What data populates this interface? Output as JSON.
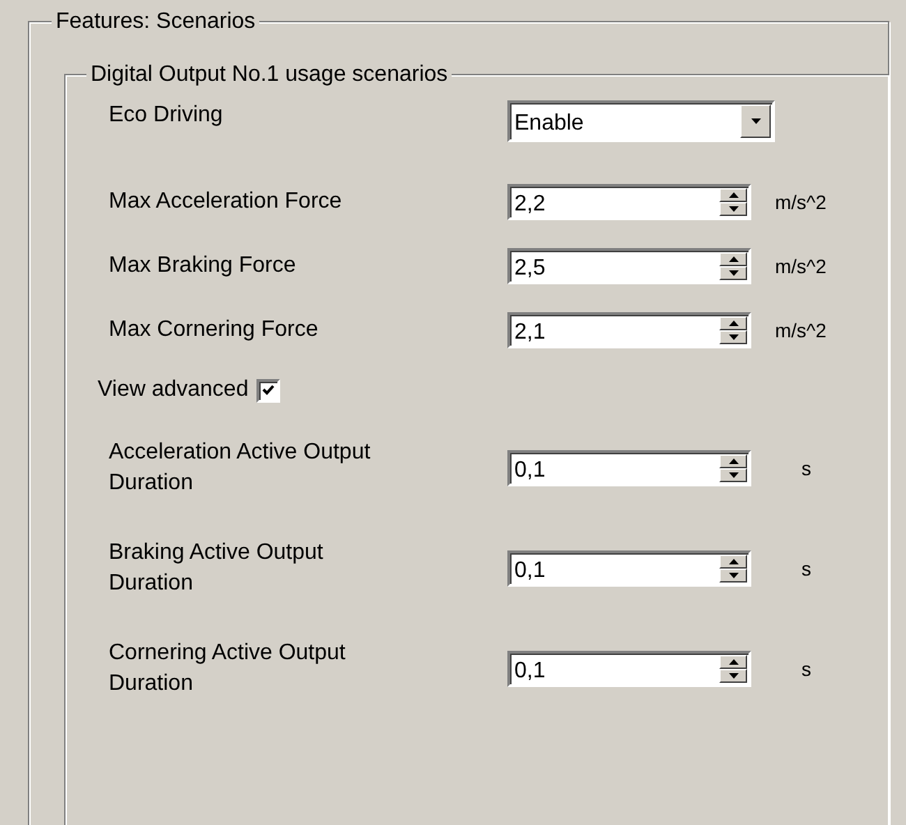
{
  "group": {
    "title": "Features: Scenarios",
    "subgroup": {
      "title": "Digital Output No.1 usage scenarios",
      "fields": [
        {
          "kind": "dropdown",
          "label": "Eco Driving",
          "value": "Enable"
        },
        {
          "kind": "spin",
          "label": "Max Acceleration Force",
          "value": "2,2",
          "unit": "m/s^2"
        },
        {
          "kind": "spin",
          "label": "Max Braking Force",
          "value": "2,5",
          "unit": "m/s^2"
        },
        {
          "kind": "spin",
          "label": "Max Cornering Force",
          "value": "2,1",
          "unit": "m/s^2"
        },
        {
          "kind": "checkbox",
          "label": "View advanced",
          "checked": true
        },
        {
          "kind": "spin",
          "label": "Acceleration Active Output Duration",
          "value": "0,1",
          "unit": "s"
        },
        {
          "kind": "spin",
          "label": "Braking Active Output Duration",
          "value": "0,1",
          "unit": "s"
        },
        {
          "kind": "spin",
          "label": "Cornering Active Output Duration",
          "value": "0,1",
          "unit": "s"
        }
      ]
    }
  }
}
